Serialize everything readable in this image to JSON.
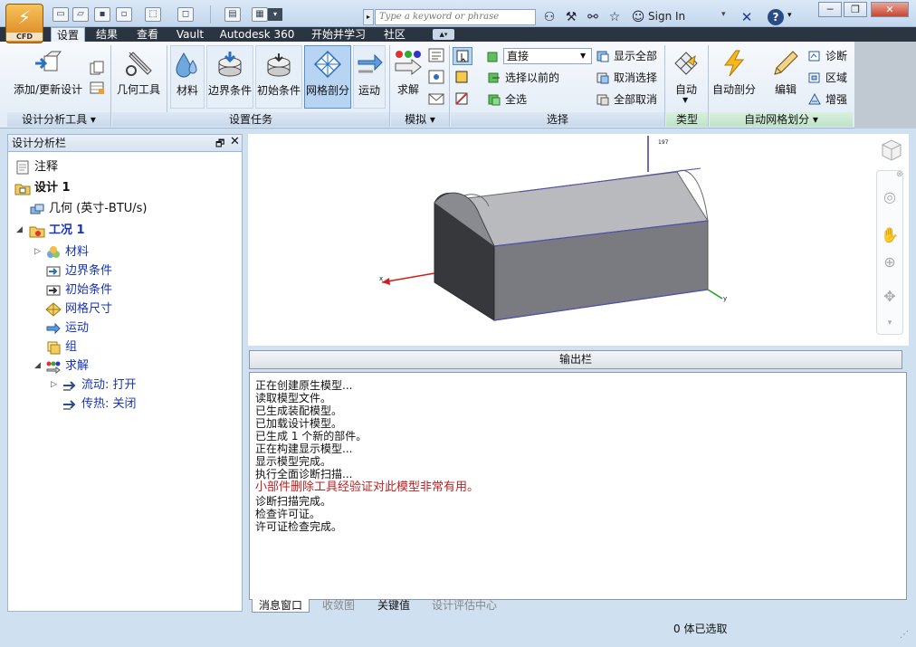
{
  "app": {
    "logo_text": "CFD"
  },
  "search": {
    "placeholder": "Type a keyword or phrase"
  },
  "account": {
    "sign_in": "Sign In"
  },
  "tabs": [
    "设置",
    "结果",
    "查看",
    "Vault",
    "Autodesk 360",
    "开始并学习",
    "社区"
  ],
  "ribbon": {
    "add_update": "添加/更新设计",
    "geometry_tools": "几何工具",
    "materials": "材料",
    "boundary": "边界条件",
    "initial": "初始条件",
    "mesh": "网格剖分",
    "motion": "运动",
    "solve": "求解",
    "select_mode": "直接",
    "select_previous": "选择以前的",
    "select_all": "全选",
    "show_all": "显示全部",
    "deselect": "取消选择",
    "deselect_all": "全部取消",
    "auto": "自动",
    "auto_mesh": "自动剖分",
    "edit": "编辑",
    "diagnose": "诊断",
    "region": "区域",
    "enhance": "增强",
    "groups": {
      "design_tools": "设计分析工具",
      "setup_tasks": "设置任务",
      "simulation": "模拟",
      "selection": "选择",
      "type": "类型",
      "auto_mesh": "自动网格划分"
    }
  },
  "design_panel": {
    "title": "设计分析栏",
    "tree": {
      "notes": "注释",
      "design": "设计 1",
      "geometry": "几何 (英寸-BTU/s)",
      "scenario": "工况 1",
      "materials": "材料",
      "boundary": "边界条件",
      "initial": "初始条件",
      "mesh_size": "网格尺寸",
      "motion": "运动",
      "groups": "组",
      "solve": "求解",
      "flow": "流动: 打开",
      "heat": "传热: 关闭"
    }
  },
  "viewport": {
    "axis_number": "197",
    "axis_x": "x",
    "axis_y": "y"
  },
  "output": {
    "title": "输出栏",
    "lines": [
      "正在创建原生模型...",
      "读取模型文件。",
      "已生成装配模型。",
      "已加载设计模型。",
      "已生成 1 个新的部件。",
      "正在构建显示模型...",
      "显示模型完成。",
      "执行全面诊断扫描...",
      "小部件删除工具经验证对此模型非常有用。",
      "诊断扫描完成。",
      "检查许可证。",
      "许可证检查完成。"
    ],
    "tabs": [
      "消息窗口",
      "收敛图",
      "关键值",
      "设计评估中心"
    ]
  },
  "status": {
    "selection": "0 体已选取"
  },
  "colors": {
    "title_bar": "#c9dcf0",
    "tab_bar": "#2b3441",
    "warning": "#c02020",
    "selected_tool": "#b7d5f3"
  }
}
